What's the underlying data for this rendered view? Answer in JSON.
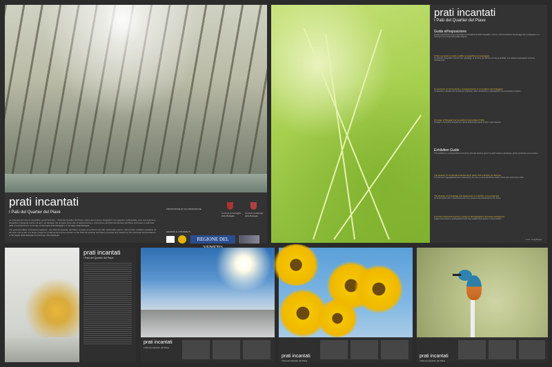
{
  "poster_main": {
    "title": "prati incantati",
    "subtitle": "I Palù del Quartier del Piave",
    "intro_it": "La proposta del volume fotografico «prati incantati – I Palù del Quartier del Piave» nasce da un lavoro fotografico con supporto multimediale, ed è una selezione fotografica sviluppata anche sul web, nel dettaglio del progetto più ampio di valorizzazione e promozione del Palù del Quartier del Piave promosso e realizzato dalla amministrazione comunale di Sernaglia della Battaglia e di Moriago della Battaglia.",
    "intro_en": "The proposal called 'enchanted meadows – the Palù del Quartier del Piave' consists of a photo book with multimedia support, and a photo exhibition available on the web, and is part of a larger project for enhancement and promotion of the Palù del Quartier del Piave promoted and realized by the municipal administrations of Sernaglia della Battaglia and Moriago della Battaglia.",
    "sponsor_label": "PROMOZIONE DI VALORIZZAZIONE",
    "crest_1": "Comune di Sernaglia della Battaglia",
    "crest_2": "Comune di Moriago della Battaglia",
    "contributors_label": "EDIZIONI E CONTRIBUTI",
    "region_logo": "REGIONE DEL VENETO"
  },
  "poster_guide": {
    "title": "prati incantati",
    "subtitle": "I Palù del Quartier del Piave",
    "sections": [
      {
        "head": "Guida all'esposizione",
        "sub": "",
        "text": "Questa esposizione mira a presentare le peculiarità del Palù fotografico, ricerca e documentazione di paesaggi che si sviluppano e si rinnovano con il trascorrere delle stagioni."
      },
      {
        "head": "",
        "sub": "Il Palù secondo il mondo: scalfire la superficie del paesaggio.",
        "text": "Un itinerario fotografico che percorre i paesaggi, le persone, gli animali e la natura del Palù; una varietà di paesaggi in continuo cambiamento."
      },
      {
        "head": "",
        "sub": "Un percorso di conoscenza e consapevolezza in un territorio da proteggere.",
        "text": "Un ambiente naturale ricco di elementi di grande valore naturalistico e paesaggistico da conservare e tutelare."
      },
      {
        "head": "",
        "sub": "Un luogo di fotografi che ha scelto di raccontare il Palù.",
        "text": "Immagini e racconti di fotografi che hanno attraversato questi luoghi in ogni stagione."
      },
      {
        "head": "Exhibition Guide",
        "sub": "",
        "text": "This exhibition is a loving tribute to a territory that has become part of us and includes a landscape, photo, production and emotions."
      },
      {
        "head": "",
        "sub": "The itinerary of emotional experiences in touch with a territory to discover.",
        "text": "The Palù are a geographical area, traversed by the river, an area that shows itself to those who know how to look."
      },
      {
        "head": "",
        "sub": "The itinerary of knowledge and awareness in a territory to be protected.",
        "text": "An environment rich in natural elements to be preserved and protected for the future."
      },
      {
        "head": "",
        "sub": "A territory lived and loved by a group of photographers who have portrayed it.",
        "text": "Images and stories by photographers who have walked these places in every season."
      }
    ],
    "credit": "Foto: Luigi Borga"
  },
  "strip": [
    {
      "title": "prati incantati",
      "subtitle": "I Palù del Quartier del Piave"
    },
    {
      "title": "prati incantati",
      "subtitle": "I Palù del Quartier del Piave"
    },
    {
      "title": "prati incantati",
      "subtitle": "I Palù del Quartier del Piave"
    },
    {
      "title": "prati incantati",
      "subtitle": "I Palù del Quartier del Piave"
    }
  ],
  "colors": {
    "background": "#2b2b2b",
    "panel": "#333333",
    "accent": "#e8c23a",
    "region_blue": "#2a4d8f"
  }
}
